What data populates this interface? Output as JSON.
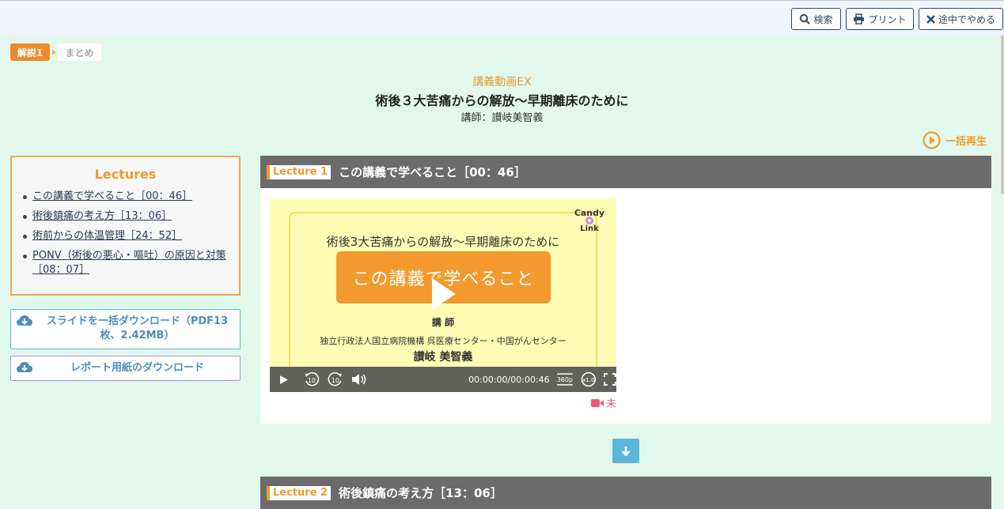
{
  "toolbar": {
    "search_label": "検索",
    "print_label": "プリント",
    "quit_label": "途中でやめる"
  },
  "breadcrumb": {
    "step1": "解説1",
    "step2": "まとめ"
  },
  "header": {
    "category": "講義動画EX",
    "title": "術後３大苦痛からの解放～早期離床のために",
    "lecturer": "講師：讃岐美智義"
  },
  "play_all_label": "一括再生",
  "lectures": {
    "heading": "Lectures",
    "items": [
      {
        "label": "この講義で学べること［00：46］"
      },
      {
        "label": "術後鎮痛の考え方［13：06］"
      },
      {
        "label": "術前からの体温管理［24：52］"
      },
      {
        "label": "PONV（術後の悪心・嘔吐）の原因と対策［08：07］"
      }
    ]
  },
  "downloads": {
    "slides_label": "スライドを一括ダウンロード（PDF13枚、2.42MB）",
    "report_label": "レポート用紙のダウンロード"
  },
  "lecture1": {
    "tag": "Lecture 1",
    "title": "この講義で学べること［00：46］",
    "status": "未"
  },
  "lecture2": {
    "tag": "Lecture 2",
    "title": "術後鎮痛の考え方［13：06］"
  },
  "video": {
    "slide_title": "術後3大苦痛からの解放～早期離床のために",
    "slide_badge": "この講義で学べること",
    "slide_lecturer_label": "講 師",
    "slide_org": "独立行政法人国立病院機構 呉医療センター・中国がんセンター",
    "slide_name": "讃岐 美智義",
    "logo_line1": "Candy",
    "logo_line2": "Link",
    "time": "00:00:00/00:00:46",
    "quality": "360p",
    "speed": "x1.0",
    "rewind": "10",
    "forward": "10"
  },
  "colors": {
    "accent": "#ef9a2d",
    "background": "#e3f8ec",
    "lecture_header": "#6b6b6b",
    "status": "#ef5a78"
  }
}
